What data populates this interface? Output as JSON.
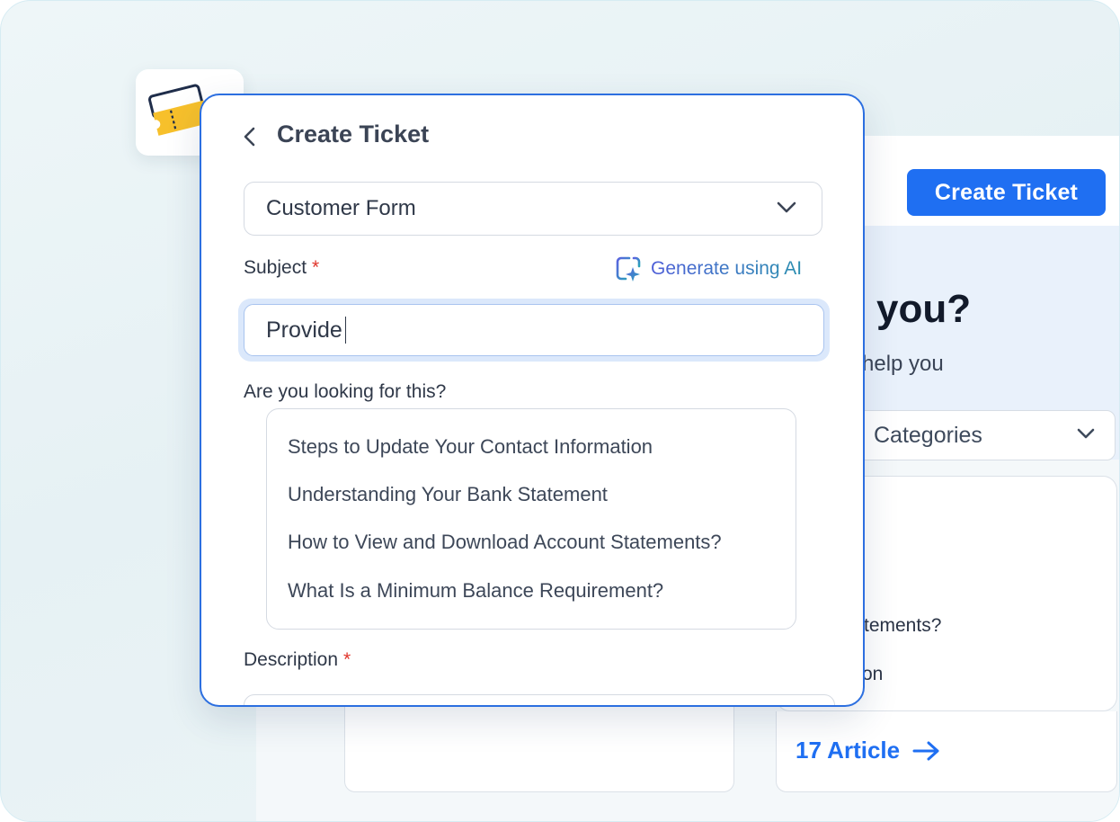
{
  "background": {
    "create_ticket_button": "Create Ticket",
    "hero_title": "you?",
    "hero_subtitle": "help you",
    "categories_select": "Categories",
    "card_line_1": "tements?",
    "card_line_2": "on",
    "article_link": "17 Article"
  },
  "modal": {
    "title": "Create Ticket",
    "form_select": "Customer Form",
    "subject_label": "Subject",
    "required_mark": "*",
    "generate_ai": "Generate using AI",
    "subject_value": "Provide",
    "looking_label": "Are you looking for this?",
    "suggestions": [
      "Steps to Update Your Contact Information",
      "Understanding Your Bank Statement",
      "How to View and Download Account Statements?",
      "What Is a Minimum Balance Requirement?"
    ],
    "description_label": "Description"
  },
  "colors": {
    "accent": "#1f6ff2",
    "modal_border": "#2c6fe0",
    "required": "#e0352b",
    "ticket_yellow": "#f7c02b",
    "download_green": "#3fb562"
  },
  "icons": [
    "back-chevron-icon",
    "chevron-down-icon",
    "ai-sparkle-icon",
    "ticket-download-icon",
    "arrow-right-icon"
  ]
}
